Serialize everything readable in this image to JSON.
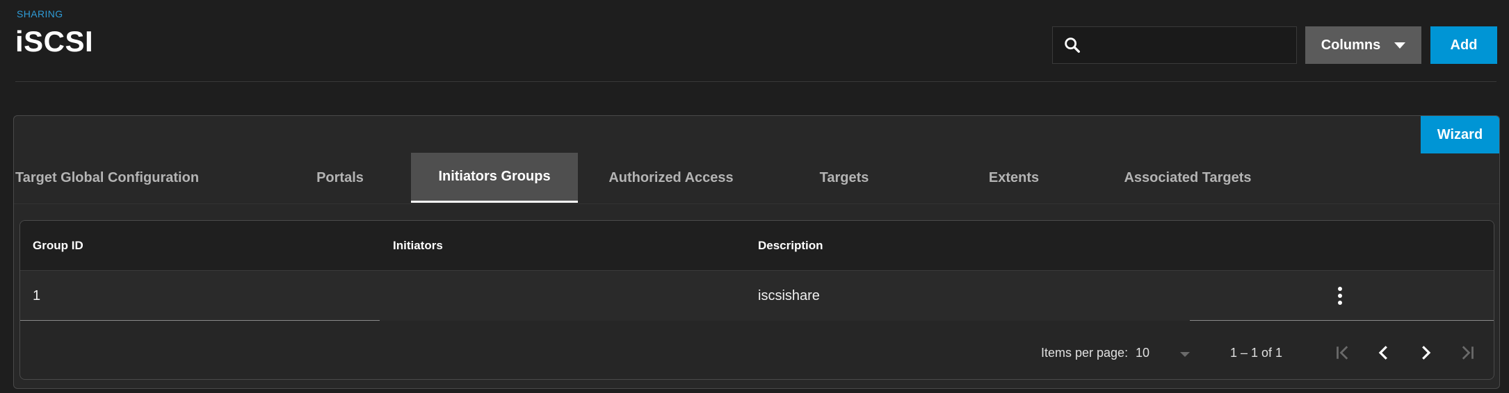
{
  "header": {
    "breadcrumb": "SHARING",
    "title": "iSCSI",
    "search_placeholder": "",
    "columns_label": "Columns",
    "add_label": "Add"
  },
  "card": {
    "wizard_label": "Wizard",
    "tabs": [
      {
        "label": "Target Global Configuration",
        "active": false
      },
      {
        "label": "Portals",
        "active": false
      },
      {
        "label": "Initiators Groups",
        "active": true
      },
      {
        "label": "Authorized Access",
        "active": false
      },
      {
        "label": "Targets",
        "active": false
      },
      {
        "label": "Extents",
        "active": false
      },
      {
        "label": "Associated Targets",
        "active": false
      }
    ]
  },
  "table": {
    "columns": [
      "Group ID",
      "Initiators",
      "Description"
    ],
    "rows": [
      {
        "group_id": "1",
        "initiators": "",
        "description": "iscsishare"
      }
    ]
  },
  "paginator": {
    "items_per_page_label": "Items per page:",
    "page_size": "10",
    "range_label": "1 – 1 of 1"
  },
  "colors": {
    "accent": "#0095d5",
    "breadcrumb": "#2f9bd6",
    "background": "#1e1e1e",
    "card": "#282828",
    "active_tab": "#4f4f4f",
    "columns_button": "#5b5b5b"
  },
  "icons": {
    "search": "search-icon",
    "columns_caret": "caret-down-icon",
    "row_menu": "more-vert-icon",
    "first_page": "first-page-icon",
    "prev_page": "chevron-left-icon",
    "next_page": "chevron-right-icon",
    "last_page": "last-page-icon"
  }
}
